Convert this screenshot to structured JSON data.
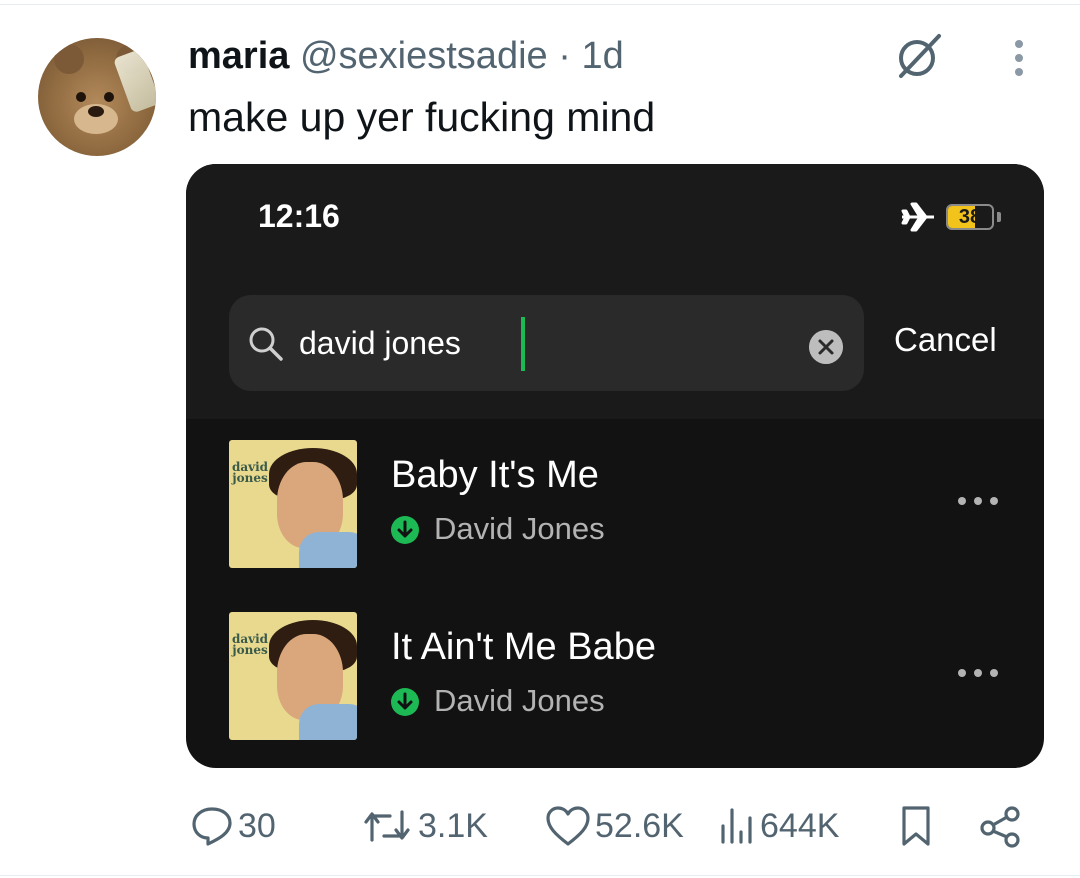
{
  "tweet": {
    "display_name": "maria",
    "handle": "@sexiestsadie",
    "separator": "·",
    "age": "1d",
    "text": "make up yer fucking mind",
    "avatar_icon": "teddy-bear-avatar",
    "grok_icon": "slashed-circle-icon",
    "more_icon": "vertical-ellipsis-icon"
  },
  "embedded_screenshot": {
    "status": {
      "time": "12:16",
      "airplane_icon": "airplane-icon",
      "battery_level": "38",
      "battery_fraction": 0.38
    },
    "search": {
      "value": "david jones",
      "search_icon": "search-icon",
      "clear_icon": "clear-x-icon",
      "cancel_label": "Cancel"
    },
    "results": [
      {
        "title": "Baby It's Me",
        "artist": "David Jones",
        "cover_label": "david jones",
        "downloaded_icon": "downloaded-arrow-icon",
        "more_icon": "horizontal-ellipsis-icon"
      },
      {
        "title": "It Ain't Me Babe",
        "artist": "David Jones",
        "cover_label": "david jones",
        "downloaded_icon": "downloaded-arrow-icon",
        "more_icon": "horizontal-ellipsis-icon"
      }
    ]
  },
  "actions": {
    "replies": "30",
    "reposts": "3.1K",
    "likes": "52.6K",
    "views": "644K",
    "reply_icon": "speech-bubble-icon",
    "repost_icon": "repost-arrows-icon",
    "like_icon": "heart-icon",
    "views_icon": "bar-chart-icon",
    "bookmark_icon": "bookmark-icon",
    "share_icon": "share-nodes-icon"
  },
  "colors": {
    "text_primary": "#0f1419",
    "text_secondary": "#536471",
    "phone_bg": "#121212",
    "spotify_green": "#1db954",
    "battery_yellow": "#f2c31a"
  }
}
